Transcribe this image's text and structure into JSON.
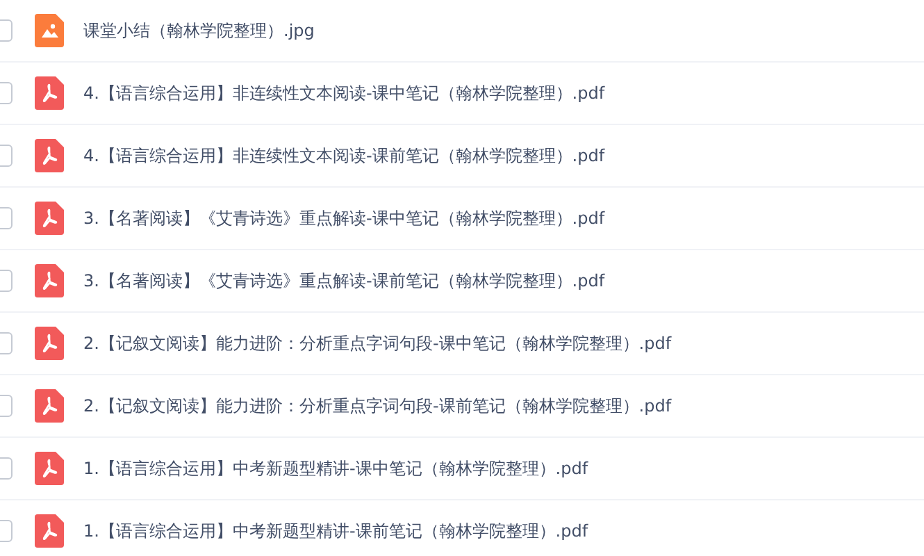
{
  "files": [
    {
      "kind": "image",
      "name": "课堂小结（翰林学院整理）.jpg",
      "checked": false
    },
    {
      "kind": "pdf",
      "name": "4.【语言综合运用】非连续性文本阅读-课中笔记（翰林学院整理）.pdf",
      "checked": false
    },
    {
      "kind": "pdf",
      "name": "4.【语言综合运用】非连续性文本阅读-课前笔记（翰林学院整理）.pdf",
      "checked": false
    },
    {
      "kind": "pdf",
      "name": "3.【名著阅读】《艾青诗选》重点解读-课中笔记（翰林学院整理）.pdf",
      "checked": false
    },
    {
      "kind": "pdf",
      "name": "3.【名著阅读】《艾青诗选》重点解读-课前笔记（翰林学院整理）.pdf",
      "checked": false
    },
    {
      "kind": "pdf",
      "name": "2.【记叙文阅读】能力进阶：分析重点字词句段-课中笔记（翰林学院整理）.pdf",
      "checked": false
    },
    {
      "kind": "pdf",
      "name": "2.【记叙文阅读】能力进阶：分析重点字词句段-课前笔记（翰林学院整理）.pdf",
      "checked": false
    },
    {
      "kind": "pdf",
      "name": "1.【语言综合运用】中考新题型精讲-课中笔记（翰林学院整理）.pdf",
      "checked": false
    },
    {
      "kind": "pdf",
      "name": "1.【语言综合运用】中考新题型精讲-课前笔记（翰林学院整理）.pdf",
      "checked": false
    }
  ]
}
